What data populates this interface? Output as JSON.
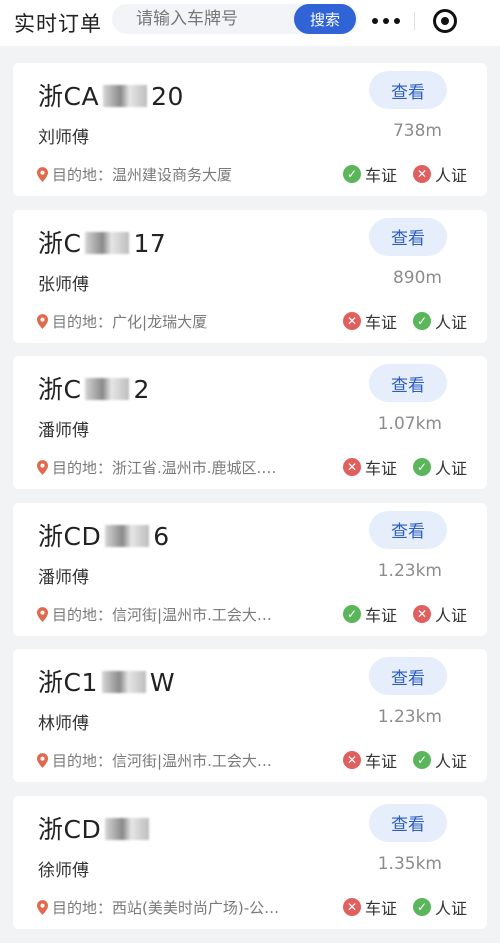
{
  "header": {
    "title": "实时订单",
    "search_placeholder": "请输入车牌号",
    "search_button": "搜索"
  },
  "colors": {
    "accent": "#2f63d6",
    "ok": "#5bb65b",
    "fail": "#e06060"
  },
  "orders": [
    {
      "plate_prefix": "浙CA",
      "plate_suffix": "20",
      "view_label": "查看",
      "driver": "刘师傅",
      "distance": "738m",
      "destination_label": "目的地：",
      "destination": "温州建设商务大厦",
      "car_cert_label": "车证",
      "car_cert_ok": true,
      "person_cert_label": "人证",
      "person_cert_ok": false
    },
    {
      "plate_prefix": "浙C",
      "plate_suffix": "17",
      "view_label": "查看",
      "driver": "张师傅",
      "distance": "890m",
      "destination_label": "目的地：",
      "destination": "广化|龙瑞大厦",
      "car_cert_label": "车证",
      "car_cert_ok": false,
      "person_cert_label": "人证",
      "person_cert_ok": true
    },
    {
      "plate_prefix": "浙C",
      "plate_suffix": "2",
      "view_label": "查看",
      "driver": "潘师傅",
      "distance": "1.07km",
      "destination_label": "目的地：",
      "destination": "浙江省.温州市.鹿城区.…",
      "car_cert_label": "车证",
      "car_cert_ok": false,
      "person_cert_label": "人证",
      "person_cert_ok": true
    },
    {
      "plate_prefix": "浙CD",
      "plate_suffix": "6",
      "view_label": "查看",
      "driver": "潘师傅",
      "distance": "1.23km",
      "destination_label": "目的地：",
      "destination": "信河街|温州市.工会大…",
      "car_cert_label": "车证",
      "car_cert_ok": true,
      "person_cert_label": "人证",
      "person_cert_ok": false
    },
    {
      "plate_prefix": "浙C1",
      "plate_suffix": "W",
      "view_label": "查看",
      "driver": "林师傅",
      "distance": "1.23km",
      "destination_label": "目的地：",
      "destination": "信河街|温州市.工会大…",
      "car_cert_label": "车证",
      "car_cert_ok": false,
      "person_cert_label": "人证",
      "person_cert_ok": true
    },
    {
      "plate_prefix": "浙CD",
      "plate_suffix": "",
      "view_label": "查看",
      "driver": "徐师傅",
      "distance": "1.35km",
      "destination_label": "目的地：",
      "destination": "西站(美美时尚广场)-公…",
      "car_cert_label": "车证",
      "car_cert_ok": false,
      "person_cert_label": "人证",
      "person_cert_ok": true
    }
  ]
}
